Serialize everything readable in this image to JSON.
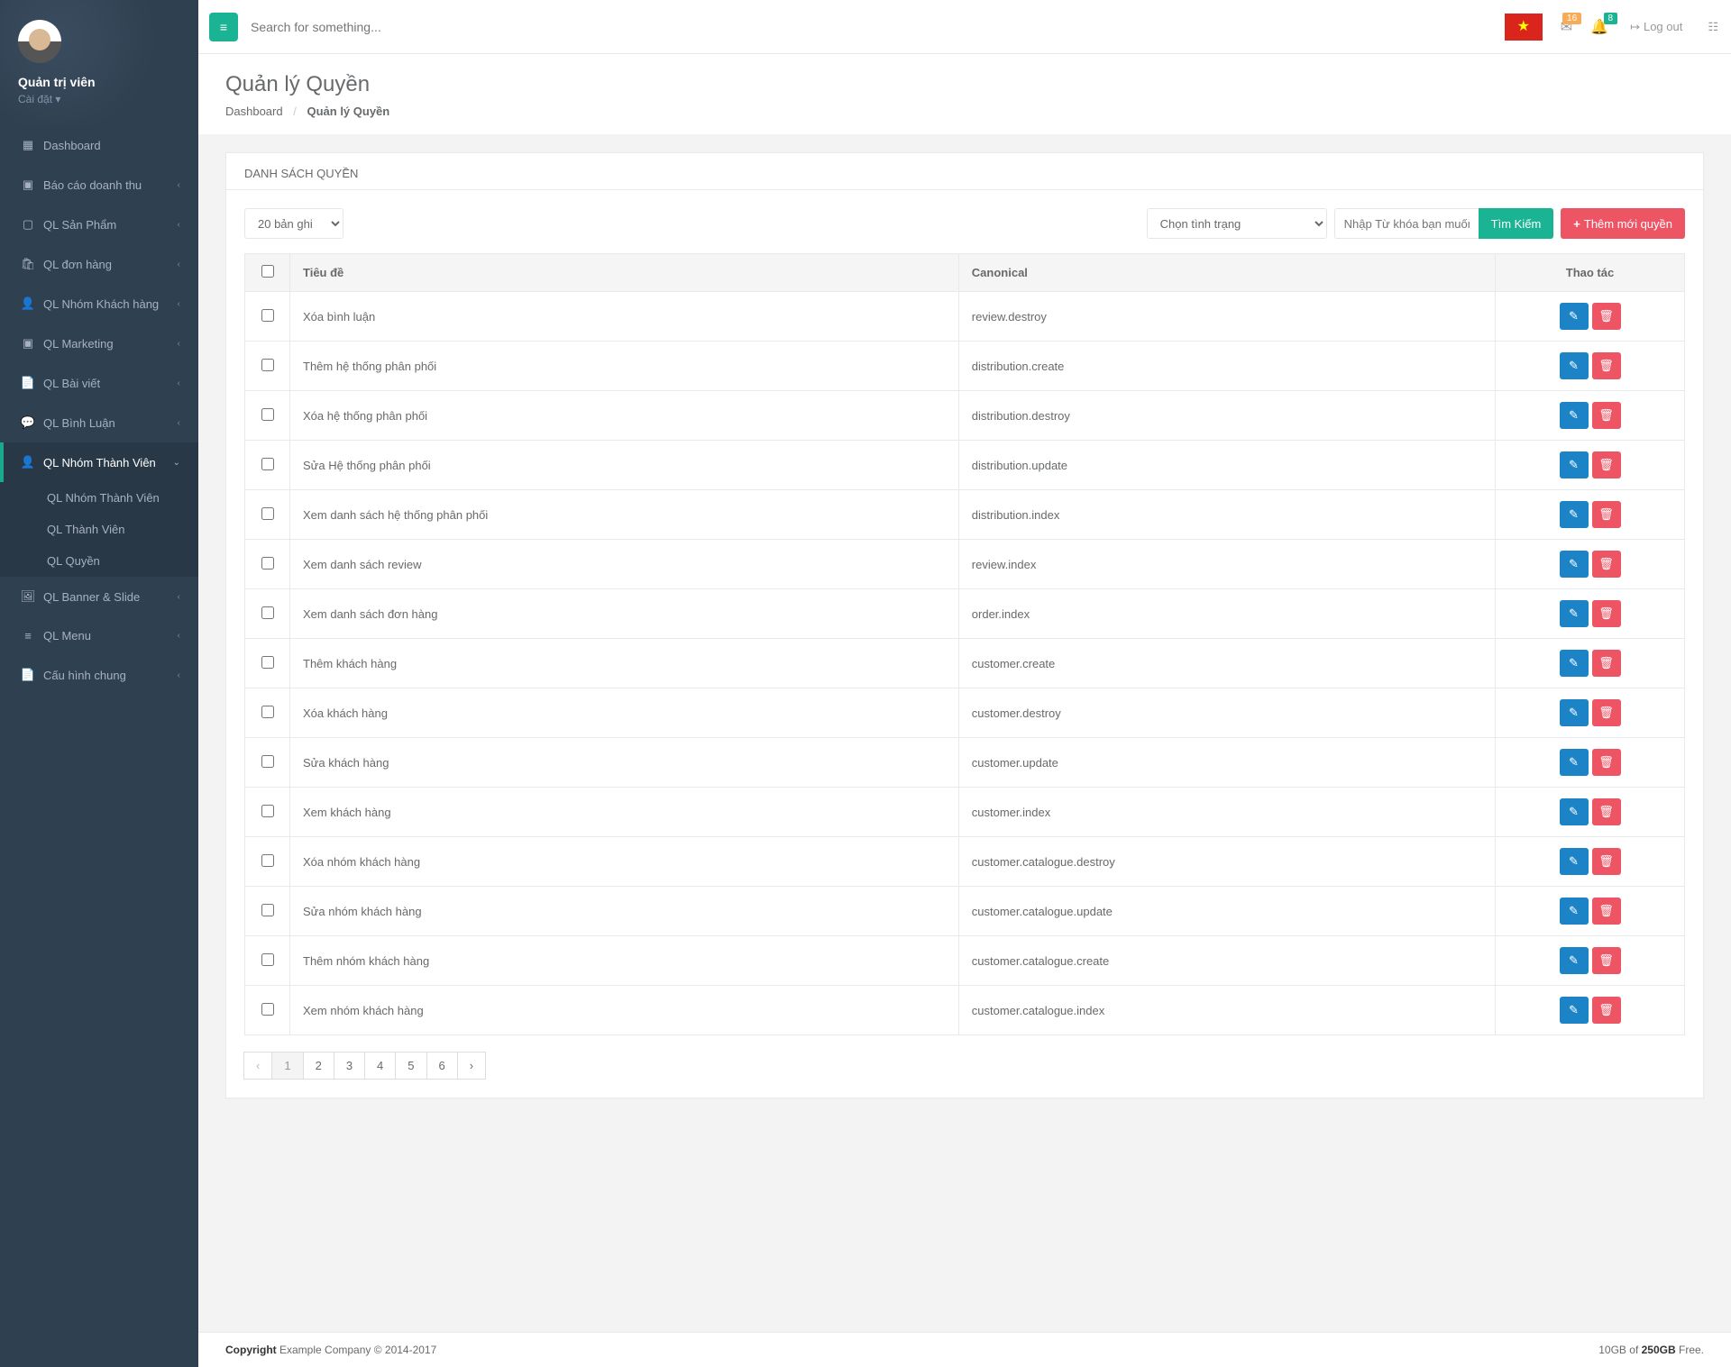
{
  "user": {
    "name": "Quản trị viên",
    "settings_label": "Cài đặt"
  },
  "top": {
    "search_placeholder": "Search for something...",
    "mail_badge": "16",
    "bell_badge": "8",
    "logout": "Log out"
  },
  "sidebar": {
    "items": [
      {
        "label": "Dashboard"
      },
      {
        "label": "Báo cáo doanh thu"
      },
      {
        "label": "QL Sản Phẩm"
      },
      {
        "label": "QL đơn hàng"
      },
      {
        "label": "QL Nhóm Khách hàng"
      },
      {
        "label": "QL Marketing"
      },
      {
        "label": "QL Bài viết"
      },
      {
        "label": "QL Bình Luận"
      },
      {
        "label": "QL Nhóm Thành Viên"
      },
      {
        "label": "QL Banner & Slide"
      },
      {
        "label": "QL Menu"
      },
      {
        "label": "Cấu hình chung"
      }
    ],
    "sub": [
      {
        "label": "QL Nhóm Thành Viên"
      },
      {
        "label": "QL Thành Viên"
      },
      {
        "label": "QL Quyền"
      }
    ]
  },
  "heading": {
    "title": "Quản lý Quyền",
    "crumb_home": "Dashboard",
    "crumb_current": "Quản lý Quyền"
  },
  "panel": {
    "title": "DANH SÁCH QUYỀN",
    "perpage": "20 bản ghi",
    "status_placeholder": "Chọn tình trạng",
    "keyword_placeholder": "Nhập Từ khóa bạn muốn tìm kiếm...",
    "search_btn": "Tìm Kiếm",
    "add_btn": "Thêm mới quyền"
  },
  "table": {
    "th_title": "Tiêu đề",
    "th_canonical": "Canonical",
    "th_actions": "Thao tác",
    "rows": [
      {
        "title": "Xóa bình luận",
        "canonical": "review.destroy"
      },
      {
        "title": "Thêm hệ thống phân phối",
        "canonical": "distribution.create"
      },
      {
        "title": "Xóa hệ thống phân phối",
        "canonical": "distribution.destroy"
      },
      {
        "title": "Sửa Hệ thống phân phối",
        "canonical": "distribution.update"
      },
      {
        "title": "Xem danh sách hệ thống phân phối",
        "canonical": "distribution.index"
      },
      {
        "title": "Xem danh sách review",
        "canonical": "review.index"
      },
      {
        "title": "Xem danh sách đơn hàng",
        "canonical": "order.index"
      },
      {
        "title": "Thêm khách hàng",
        "canonical": "customer.create"
      },
      {
        "title": "Xóa khách hàng",
        "canonical": "customer.destroy"
      },
      {
        "title": "Sửa khách hàng",
        "canonical": "customer.update"
      },
      {
        "title": "Xem khách hàng",
        "canonical": "customer.index"
      },
      {
        "title": "Xóa nhóm khách hàng",
        "canonical": "customer.catalogue.destroy"
      },
      {
        "title": "Sửa nhóm khách hàng",
        "canonical": "customer.catalogue.update"
      },
      {
        "title": "Thêm nhóm khách hàng",
        "canonical": "customer.catalogue.create"
      },
      {
        "title": "Xem nhóm khách hàng",
        "canonical": "customer.catalogue.index"
      }
    ]
  },
  "pagination": {
    "prev": "‹",
    "pages": [
      "1",
      "2",
      "3",
      "4",
      "5",
      "6"
    ],
    "next": "›",
    "active": "1"
  },
  "footer": {
    "copyright_strong": "Copyright",
    "copyright_rest": " Example Company © 2014-2017",
    "storage_pre": "10GB of ",
    "storage_strong": "250GB",
    "storage_post": " Free."
  }
}
